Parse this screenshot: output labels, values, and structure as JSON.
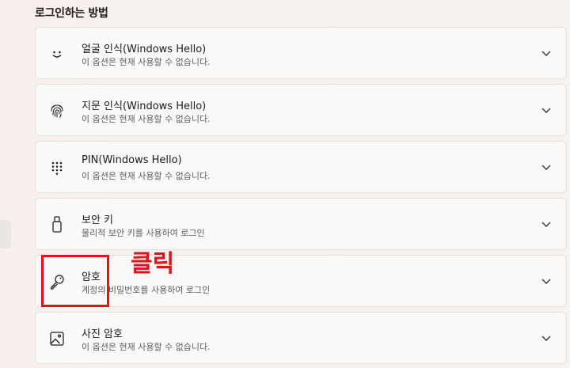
{
  "section": {
    "title": "로그인하는 방법"
  },
  "options": [
    {
      "title": "얼굴 인식(Windows Hello)",
      "subtitle": "이 옵션은 현재 사용할 수 없습니다.",
      "icon": "face-smile-icon"
    },
    {
      "title": "지문 인식(Windows Hello)",
      "subtitle": "이 옵션은 현재 사용할 수 없습니다.",
      "icon": "fingerprint-icon"
    },
    {
      "title": "PIN(Windows Hello)",
      "subtitle": "이 옵션은 현재 사용할 수 없습니다.",
      "icon": "pin-keypad-icon"
    },
    {
      "title": "보안 키",
      "subtitle": "물리적 보안 키를 사용하여 로그인",
      "icon": "usb-key-icon"
    },
    {
      "title": "암호",
      "subtitle": "계정의 비밀번호를 사용하여 로그인",
      "icon": "key-icon"
    },
    {
      "title": "사진 암호",
      "subtitle": "이 옵션은 현재 사용할 수 없습니다.",
      "icon": "picture-icon"
    }
  ],
  "annotation": {
    "label": "클릭",
    "color": "#e0141a"
  }
}
